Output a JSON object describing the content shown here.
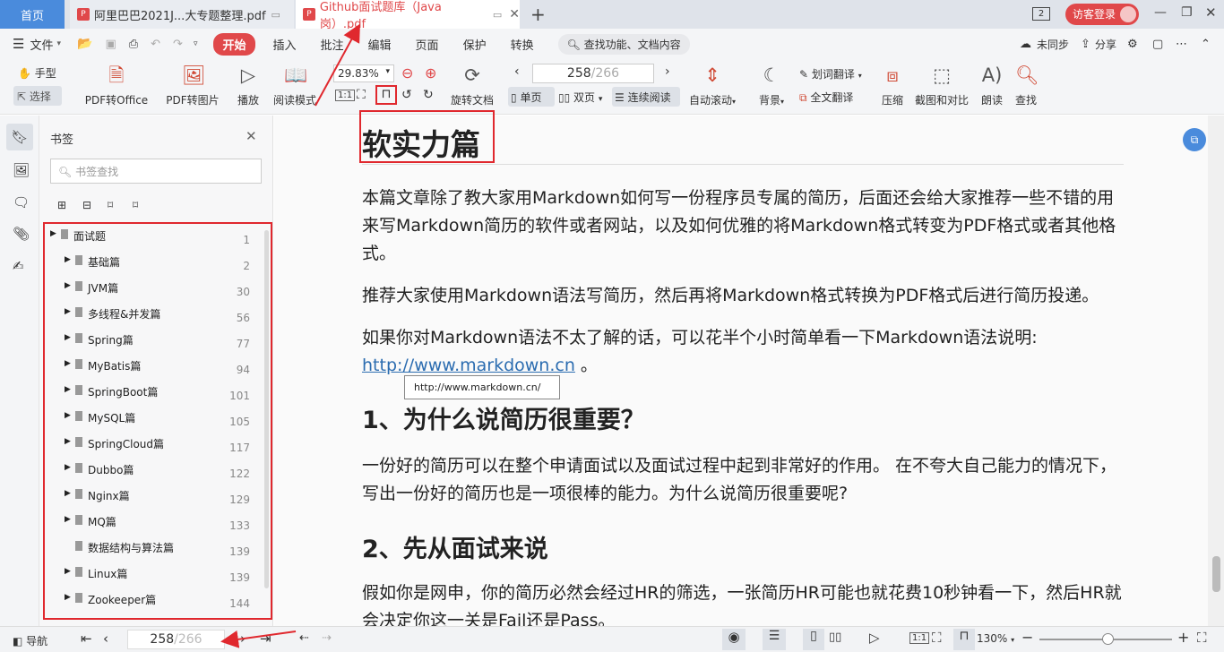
{
  "tabs": {
    "home": "首页",
    "tab1": "阿里巴巴2021J...大专题整理.pdf",
    "tab2": "Github面试题库（Java岗）.pdf",
    "add": "+",
    "window_count": "2",
    "login": "访客登录"
  },
  "menu": {
    "file": "文件",
    "start": "开始",
    "items": [
      "插入",
      "批注",
      "编辑",
      "页面",
      "保护",
      "转换"
    ],
    "search": "查找功能、文档内容",
    "sync": "未同步",
    "share": "分享"
  },
  "ribbon": {
    "hand": "手型",
    "select": "选择",
    "pdf_office": "PDF转Office",
    "pdf_image": "PDF转图片",
    "play": "播放",
    "read_mode": "阅读模式",
    "zoom": "29.83%",
    "rotate": "旋转文档",
    "page_current": "258",
    "page_total": "/266",
    "single": "单页",
    "double": "双页",
    "continuous": "连续阅读",
    "autoscroll": "自动滚动",
    "background": "背景",
    "word_translate": "划词翻译",
    "full_translate": "全文翻译",
    "compress": "压缩",
    "screenshot": "截图和对比",
    "read_aloud": "朗读",
    "find": "查找"
  },
  "bookmark": {
    "title": "书签",
    "search_placeholder": "书签查找",
    "root": {
      "label": "面试题",
      "page": "1"
    },
    "items": [
      {
        "label": "基础篇",
        "page": "2"
      },
      {
        "label": "JVM篇",
        "page": "30"
      },
      {
        "label": "多线程&并发篇",
        "page": "56"
      },
      {
        "label": "Spring篇",
        "page": "77"
      },
      {
        "label": "MyBatis篇",
        "page": "94"
      },
      {
        "label": "SpringBoot篇",
        "page": "101"
      },
      {
        "label": "MySQL篇",
        "page": "105"
      },
      {
        "label": "SpringCloud篇",
        "page": "117"
      },
      {
        "label": "Dubbo篇",
        "page": "122"
      },
      {
        "label": "Nginx篇",
        "page": "129"
      },
      {
        "label": "MQ篇",
        "page": "133"
      },
      {
        "label": "数据结构与算法篇",
        "page": "139"
      },
      {
        "label": "Linux篇",
        "page": "139"
      },
      {
        "label": "Zookeeper篇",
        "page": "144"
      }
    ]
  },
  "document": {
    "heading": "软实力篇",
    "para1": "本篇文章除了教大家用Markdown如何写一份程序员专属的简历，后面还会给大家推荐一些不错的用来写Markdown简历的软件或者网站，以及如何优雅的将Markdown格式转变为PDF格式或者其他格式。",
    "para2": "推荐大家使用Markdown语法写简历，然后再将Markdown格式转换为PDF格式后进行简历投递。",
    "para3": "如果你对Markdown语法不太了解的话，可以花半个小时简单看一下Markdown语法说明:",
    "link": "http://www.markdown.cn",
    "link_suffix": " 。",
    "tooltip": "http://www.markdown.cn/",
    "h1": "1、为什么说简历很重要？",
    "para4": "一份好的简历可以在整个申请面试以及面试过程中起到非常好的作用。 在不夸大自己能力的情况下，写出一份好的简历也是一项很棒的能力。为什么说简历很重要呢?",
    "h2": "2、先从面试来说",
    "para5": "假如你是网申，你的简历必然会经过HR的筛选，一张简历HR可能也就花费10秒钟看一下，然后HR就会决定你这一关是Fail还是Pass。"
  },
  "status": {
    "nav": "导航",
    "page_current": "258",
    "page_total": "/266",
    "zoom": "130%"
  },
  "colors": {
    "accent": "#e0282e",
    "tab_red": "#e0484a",
    "link": "#2b6cb0"
  }
}
